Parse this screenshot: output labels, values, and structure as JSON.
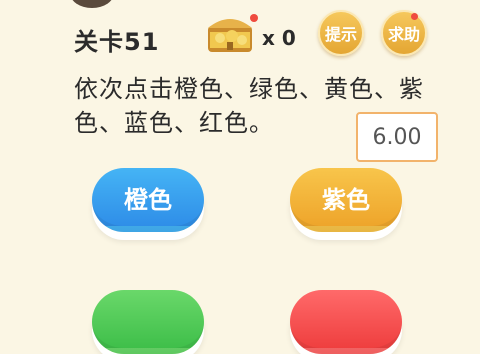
{
  "header": {
    "level_label": "关卡51",
    "chest_icon": "treasure-chest-icon",
    "chest_count": "x 0",
    "hint_label": "提示",
    "help_label": "求助"
  },
  "instruction": "依次点击橙色、绿色、黄色、紫色、蓝色、红色。",
  "timer": "6.00",
  "color_buttons": [
    {
      "label": "橙色",
      "color": "#3a9ff0"
    },
    {
      "label": "紫色",
      "color": "#f2b23c"
    }
  ],
  "partial_buttons": [
    {
      "color": "#52cc52"
    },
    {
      "color": "#f24d4d"
    }
  ]
}
